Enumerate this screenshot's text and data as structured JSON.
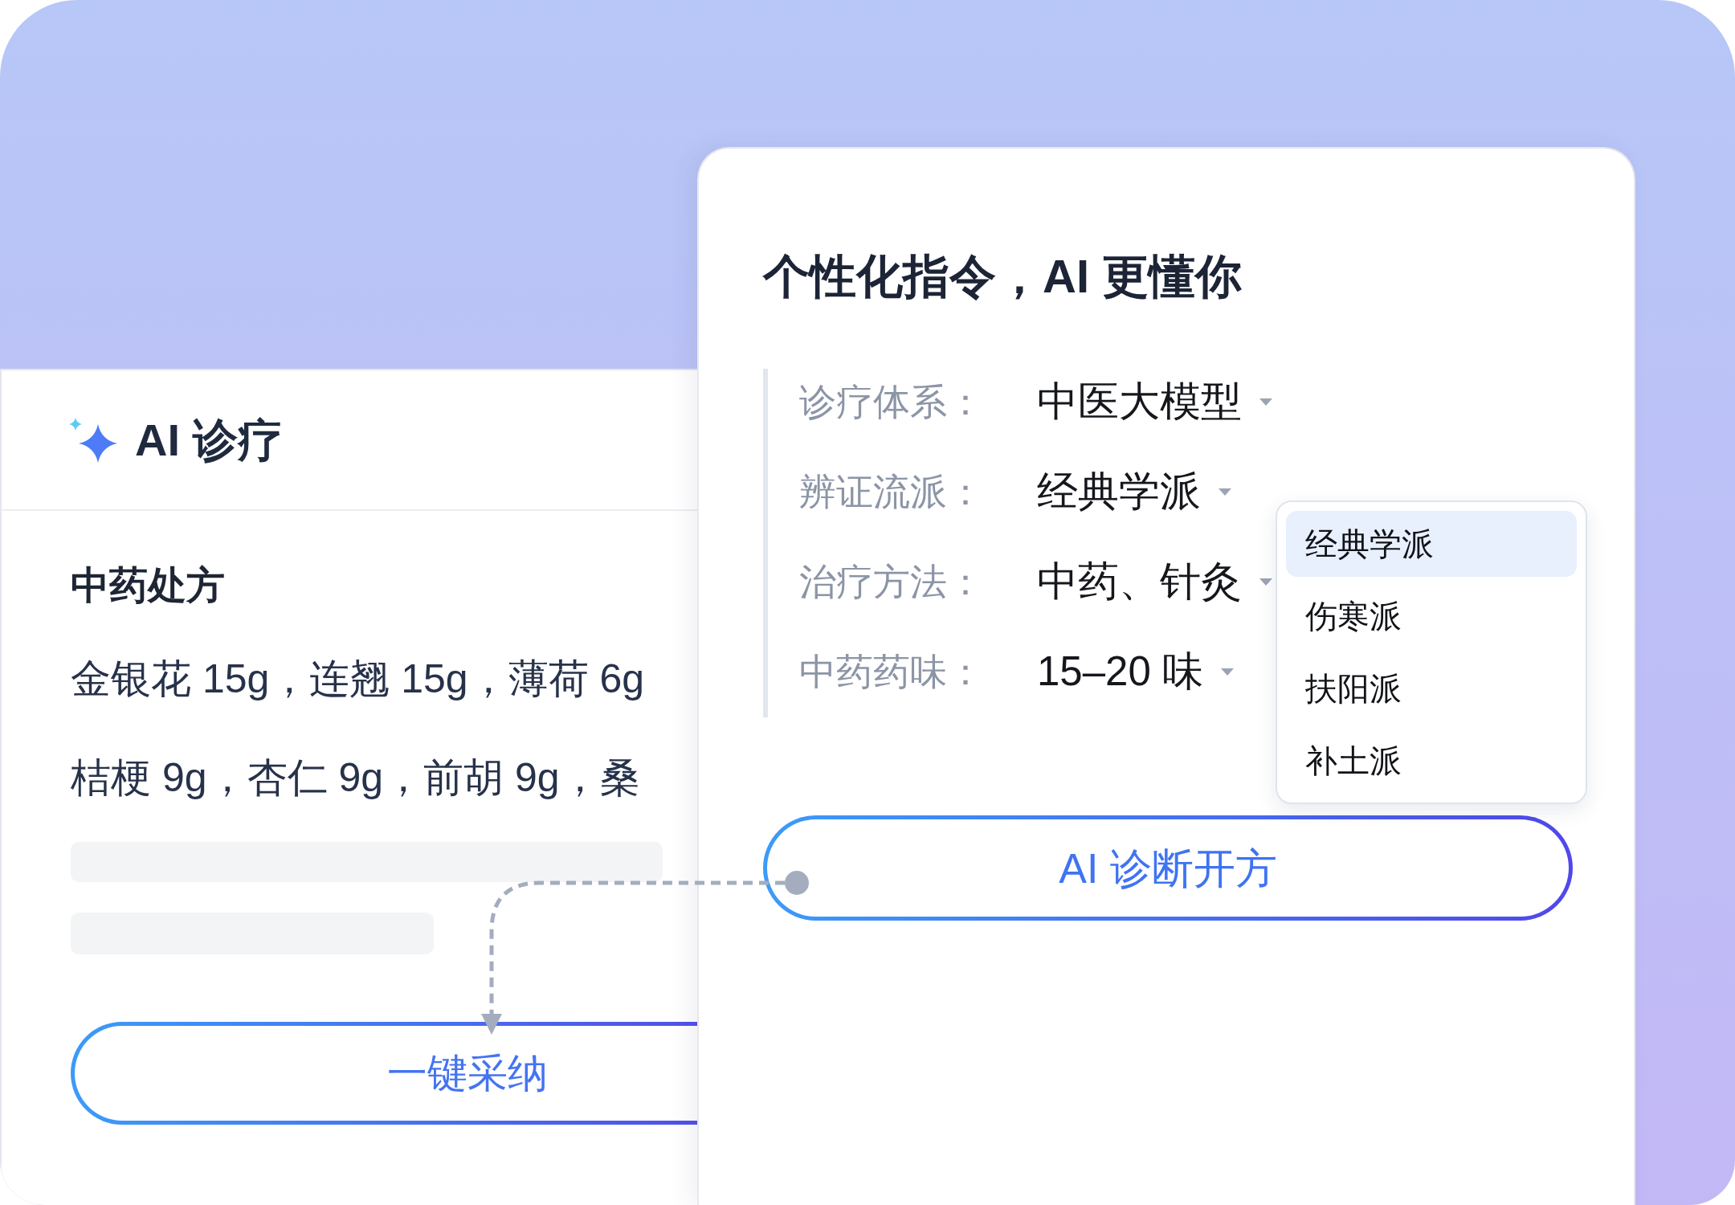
{
  "left_panel": {
    "title": "AI 诊疗",
    "section_title": "中药处方",
    "prescription_lines": [
      "金银花 15g，连翘 15g，薄荷 6g",
      "桔梗 9g，杏仁 9g，前胡 9g，桑"
    ],
    "adopt_button": "一键采纳"
  },
  "right_panel": {
    "title": "个性化指令，AI 更懂你",
    "settings": [
      {
        "label": "诊疗体系：",
        "value": "中医大模型"
      },
      {
        "label": "辨证流派：",
        "value": "经典学派"
      },
      {
        "label": "治疗方法：",
        "value": "中药、针灸"
      },
      {
        "label": "中药药味：",
        "value": "15–20 味"
      }
    ],
    "dropdown": {
      "options": [
        {
          "label": "经典学派",
          "selected": true
        },
        {
          "label": "伤寒派",
          "selected": false
        },
        {
          "label": "扶阳派",
          "selected": false
        },
        {
          "label": "补土派",
          "selected": false
        }
      ]
    },
    "diagnose_button": "AI 诊断开方"
  }
}
